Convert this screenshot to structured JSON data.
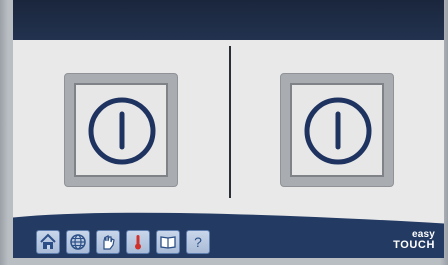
{
  "main": {
    "power_buttons": [
      {
        "name": "power-left",
        "icon": "power-icon"
      },
      {
        "name": "power-right",
        "icon": "power-icon"
      }
    ]
  },
  "toolbar": {
    "items": [
      {
        "icon": "home-icon"
      },
      {
        "icon": "globe-icon"
      },
      {
        "icon": "hand-icon"
      },
      {
        "icon": "thermometer-icon"
      },
      {
        "icon": "book-icon"
      },
      {
        "icon": "help-icon",
        "glyph": "?"
      }
    ]
  },
  "brand": {
    "line1": "easy",
    "line2": "TOUCH"
  },
  "colors": {
    "panel": "#1b2a44",
    "content": "#e9e9e9",
    "power_ring": "#1f3360",
    "toolbar_button": "#b8c7df",
    "thermometer_red": "#d1312b"
  }
}
